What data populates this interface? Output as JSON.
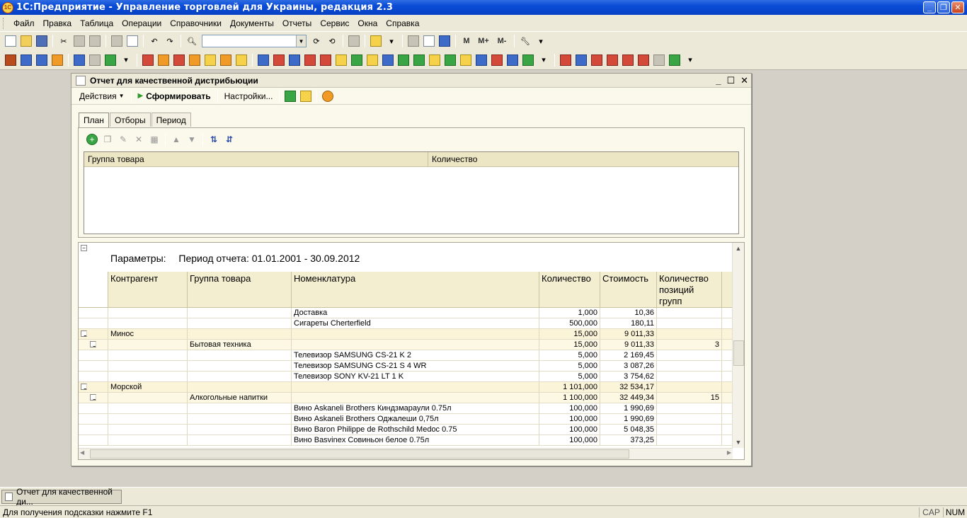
{
  "app": {
    "title": "1С:Предприятие - Управление торговлей для Украины, редакция 2.3",
    "logo_text": "1С"
  },
  "menu": [
    "Файл",
    "Правка",
    "Таблица",
    "Операции",
    "Справочники",
    "Документы",
    "Отчеты",
    "Сервис",
    "Окна",
    "Справка"
  ],
  "toolbar": {
    "search_value": "",
    "m_label": "M",
    "mplus_label": "M+",
    "mminus_label": "M-"
  },
  "window": {
    "title": "Отчет  для качественной дистрибьюции",
    "actions_label": "Действия",
    "generate_label": "Сформировать",
    "settings_label": "Настройки..."
  },
  "tabs": [
    "План",
    "Отборы",
    "Период"
  ],
  "plan_table": {
    "columns": [
      "Группа товара",
      "Количество"
    ]
  },
  "report": {
    "params_label": "Параметры:",
    "params_value": "Период отчета: 01.01.2001 - 30.09.2012",
    "columns": [
      "Контрагент",
      "Группа товара",
      "Номенклатура",
      "Количество",
      "Стоимость",
      "Количество позиций групп"
    ],
    "rows": [
      {
        "level": 3,
        "contractor": "",
        "group": "",
        "item": "Доставка",
        "qty": "1,000",
        "cost": "10,36",
        "positions": ""
      },
      {
        "level": 3,
        "contractor": "",
        "group": "",
        "item": "Сигареты Cherterfield",
        "qty": "500,000",
        "cost": "180,11",
        "positions": ""
      },
      {
        "level": 1,
        "contractor": "Минос",
        "group": "",
        "item": "",
        "qty": "15,000",
        "cost": "9 011,33",
        "positions": ""
      },
      {
        "level": 2,
        "contractor": "",
        "group": "Бытовая техника",
        "item": "",
        "qty": "15,000",
        "cost": "9 011,33",
        "positions": "3"
      },
      {
        "level": 3,
        "contractor": "",
        "group": "",
        "item": "Телевизор SAMSUNG CS-21 K 2",
        "qty": "5,000",
        "cost": "2 169,45",
        "positions": ""
      },
      {
        "level": 3,
        "contractor": "",
        "group": "",
        "item": "Телевизор SAMSUNG CS-21 S 4 WR",
        "qty": "5,000",
        "cost": "3 087,26",
        "positions": ""
      },
      {
        "level": 3,
        "contractor": "",
        "group": "",
        "item": "Телевизор SONY KV-21 LT 1 K",
        "qty": "5,000",
        "cost": "3 754,62",
        "positions": ""
      },
      {
        "level": 1,
        "contractor": "Морской",
        "group": "",
        "item": "",
        "qty": "1 101,000",
        "cost": "32 534,17",
        "positions": ""
      },
      {
        "level": 2,
        "contractor": "",
        "group": "Алкогольные напитки",
        "item": "",
        "qty": "1 100,000",
        "cost": "32 449,34",
        "positions": "15"
      },
      {
        "level": 3,
        "contractor": "",
        "group": "",
        "item": "Вино Askaneli Brothers Киндзмараули 0.75л",
        "qty": "100,000",
        "cost": "1 990,69",
        "positions": ""
      },
      {
        "level": 3,
        "contractor": "",
        "group": "",
        "item": "Вино Askaneli Brothers Оджалеши 0,75л",
        "qty": "100,000",
        "cost": "1 990,69",
        "positions": ""
      },
      {
        "level": 3,
        "contractor": "",
        "group": "",
        "item": "Вино Baron Philippe de Rothschild Medoc 0.75",
        "qty": "100,000",
        "cost": "5 048,35",
        "positions": ""
      },
      {
        "level": 3,
        "contractor": "",
        "group": "",
        "item": "Вино Basvinex Совиньон белое 0.75л",
        "qty": "100,000",
        "cost": "373,25",
        "positions": ""
      }
    ]
  },
  "taskbar": {
    "window_button": "Отчет  для качественной ди..."
  },
  "status": {
    "hint": "Для получения подсказки нажмите F1",
    "cap": "CAP",
    "num": "NUM"
  }
}
